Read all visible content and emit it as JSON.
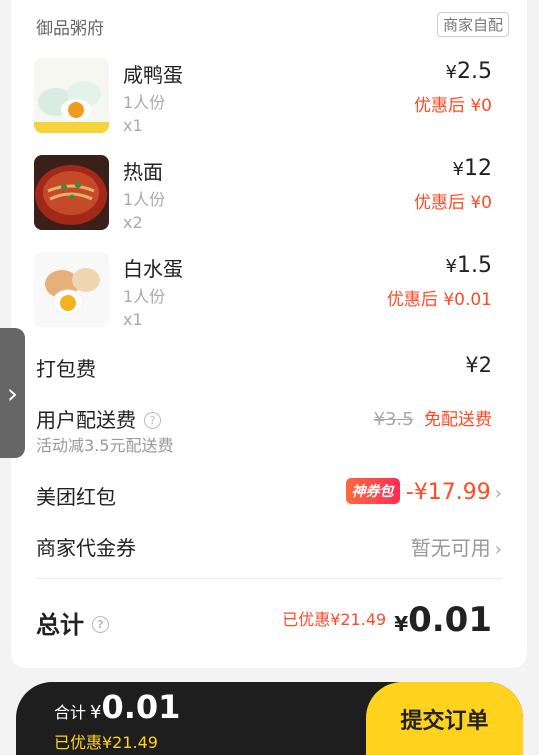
{
  "shop": {
    "name": "御品粥府",
    "delivery_tag": "商家自配"
  },
  "items": [
    {
      "name": "咸鸭蛋",
      "portion": "1人份",
      "qty": "x1",
      "price_symbol": "¥",
      "price": "2.5",
      "discount": "优惠后 ¥0"
    },
    {
      "name": "热面",
      "portion": "1人份",
      "qty": "x2",
      "price_symbol": "¥",
      "price": "12",
      "discount": "优惠后 ¥0"
    },
    {
      "name": "白水蛋",
      "portion": "1人份",
      "qty": "x1",
      "price_symbol": "¥",
      "price": "1.5",
      "discount": "优惠后 ¥0.01"
    }
  ],
  "packing": {
    "label": "打包费",
    "value": "¥2"
  },
  "delivery": {
    "label": "用户配送费",
    "sub": "活动减3.5元配送费",
    "original": "¥3.5",
    "free_text": "免配送费"
  },
  "redpacket": {
    "label": "美团红包",
    "badge": "神券包",
    "value": "-¥17.99"
  },
  "voucher": {
    "label": "商家代金券",
    "value": "暂无可用"
  },
  "total": {
    "label": "总计",
    "saved": "已优惠¥21.49",
    "symbol": "¥",
    "value": "0.01"
  },
  "bottom_bar": {
    "sum_label": "合计",
    "symbol": "¥",
    "value": "0.01",
    "saved": "已优惠¥21.49",
    "submit_label": "提交订单"
  },
  "colors": {
    "accent_red": "#ff4a26",
    "submit_yellow": "#ffd21e",
    "bar_dark": "#1e1e1e"
  }
}
